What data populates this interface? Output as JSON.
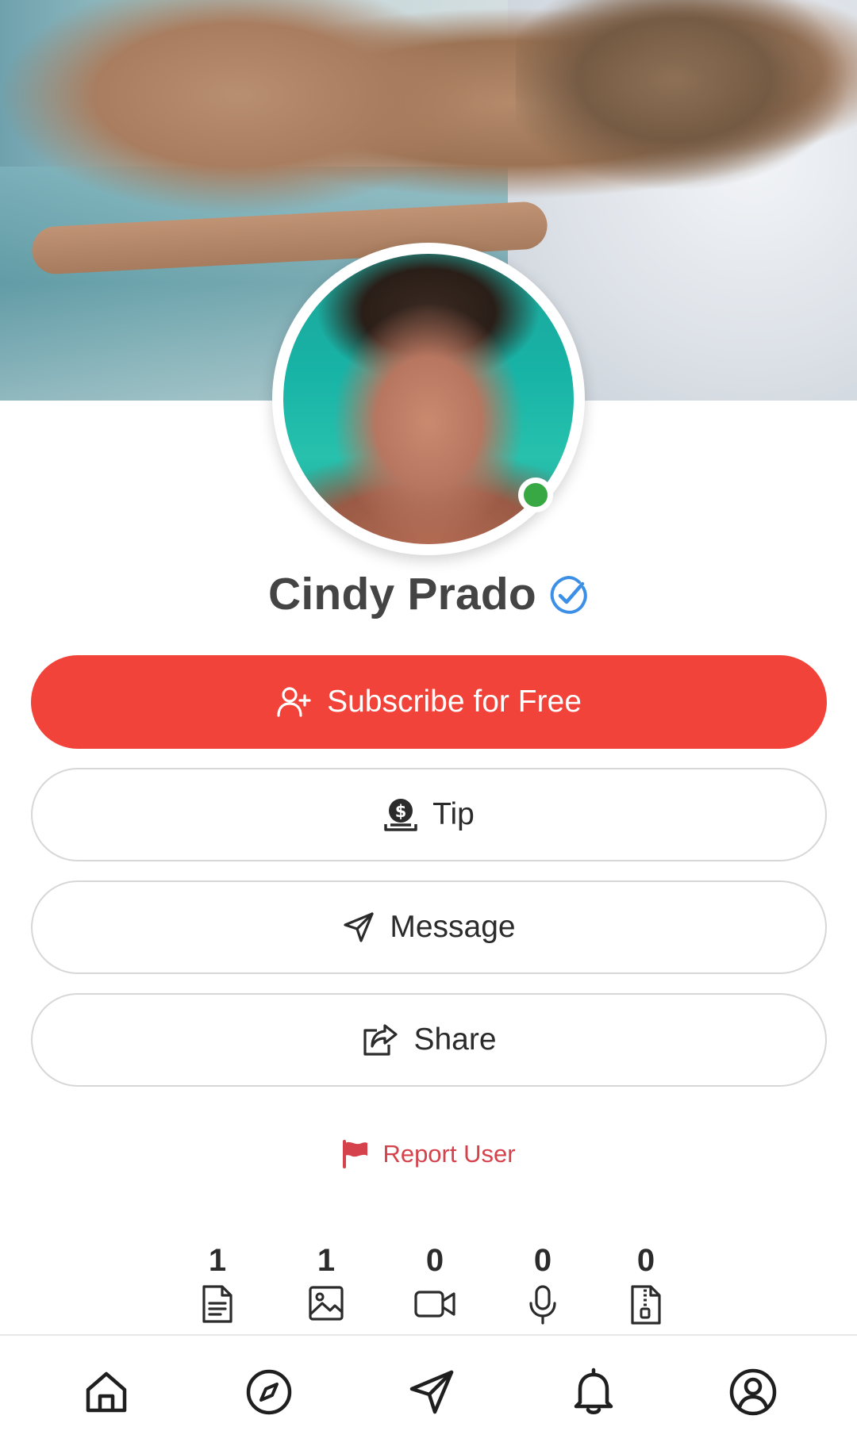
{
  "profile": {
    "name": "Cindy Prado",
    "verified": true,
    "online": true
  },
  "actions": {
    "subscribe_label": "Subscribe for Free",
    "tip_label": "Tip",
    "message_label": "Message",
    "share_label": "Share"
  },
  "report": {
    "label": "Report User"
  },
  "stats": [
    {
      "count": "1",
      "icon": "document-icon"
    },
    {
      "count": "1",
      "icon": "image-icon"
    },
    {
      "count": "0",
      "icon": "video-icon"
    },
    {
      "count": "0",
      "icon": "microphone-icon"
    },
    {
      "count": "0",
      "icon": "zip-file-icon"
    }
  ],
  "bottom_nav": [
    {
      "icon": "home-icon"
    },
    {
      "icon": "compass-icon"
    },
    {
      "icon": "send-icon"
    },
    {
      "icon": "bell-icon"
    },
    {
      "icon": "user-circle-icon"
    }
  ],
  "colors": {
    "primary": "#f2433a",
    "report": "#d6424b",
    "verified": "#3b8fe6",
    "online": "#38a845",
    "text": "#2b2b2b"
  }
}
